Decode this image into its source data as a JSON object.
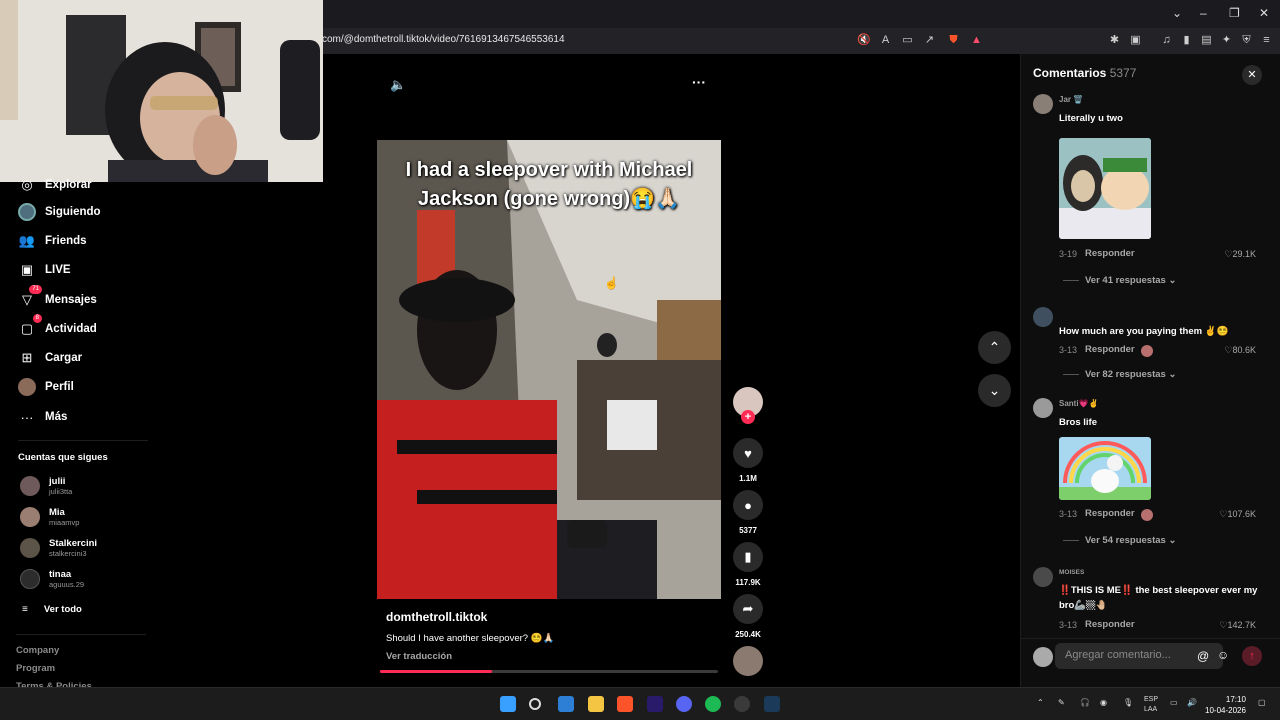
{
  "browser": {
    "url": "com/@domthetroll.tiktok/video/7616913467546553614"
  },
  "sidebar": {
    "items": [
      {
        "label": "Explorar",
        "icon": "compass-icon"
      },
      {
        "label": "Siguiendo",
        "icon": "following-avatar-icon"
      },
      {
        "label": "Friends",
        "icon": "friends-icon"
      },
      {
        "label": "LIVE",
        "icon": "live-icon"
      },
      {
        "label": "Mensajes",
        "icon": "messages-icon",
        "badge": "71"
      },
      {
        "label": "Actividad",
        "icon": "activity-icon",
        "badge": "8"
      },
      {
        "label": "Cargar",
        "icon": "upload-icon"
      },
      {
        "label": "Perfil",
        "icon": "profile-avatar-icon"
      },
      {
        "label": "Más",
        "icon": "more-dots-icon"
      }
    ],
    "following_title": "Cuentas que sigues",
    "following": [
      {
        "name": "julii",
        "user": "julii3tta"
      },
      {
        "name": "Mia",
        "user": "miaamvp"
      },
      {
        "name": "Stalkercini",
        "user": "stalkercini3"
      },
      {
        "name": "tinaa",
        "user": "aguuus.29"
      }
    ],
    "see_all": "Ver todo",
    "footer": [
      "Company",
      "Program",
      "Terms & Policies"
    ]
  },
  "video": {
    "caption_line1": "I had a sleepover with Michael",
    "caption_line2": "Jackson (gone wrong)😭🙏🏻",
    "author": "domthetroll.tiktok",
    "description": "Should I have another sleepover? 😵‍💫🙏🏻",
    "translate": "Ver traducción",
    "progress": 0.33
  },
  "actions": {
    "likes": "1.1M",
    "comments": "5377",
    "saves": "117.9K",
    "shares": "250.4K"
  },
  "comments": {
    "title": "Comentarios",
    "count": "5377",
    "input_placeholder": "Agregar comentario...",
    "reply_label": "Responder",
    "items": [
      {
        "user": "Jar 🗑️",
        "text": "Literally u two",
        "date": "3-19",
        "likes": "29.1K",
        "more": "Ver 41 respuestas ⌄"
      },
      {
        "user": "",
        "text": "How much are you paying them ✌️😵‍💫",
        "date": "3-13",
        "likes": "80.6K",
        "more": "Ver 82 respuestas ⌄"
      },
      {
        "user": "Santi💗✌️",
        "text": "Bros life",
        "date": "3-13",
        "likes": "107.6K",
        "more": "Ver 54 respuestas ⌄"
      },
      {
        "user": "MOISES",
        "text": "‼️THIS IS ME‼️ the best sleepover ever my bro🦾🏼🤚🏼",
        "date": "3-13",
        "likes": "142.7K"
      }
    ]
  },
  "taskbar": {
    "lang_line1": "ESP",
    "lang_line2": "LAA",
    "time": "17:10",
    "date": "10-04-2026"
  },
  "colors": {
    "accent": "#fe2c55",
    "background": "#000000",
    "panel": "#0e0e0e"
  }
}
